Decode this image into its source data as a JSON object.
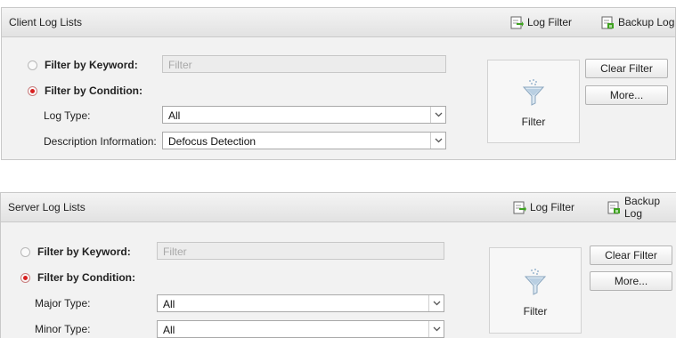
{
  "client": {
    "title": "Client Log Lists",
    "log_filter": "Log Filter",
    "backup_log": "Backup Log",
    "filter_keyword_label": "Filter by Keyword:",
    "filter_keyword_placeholder": "Filter",
    "filter_condition_label": "Filter by Condition:",
    "field1_label": "Log Type:",
    "field1_value": "All",
    "field2_label": "Description Information:",
    "field2_value": "Defocus Detection",
    "filter_button": "Filter",
    "clear_filter": "Clear Filter",
    "more": "More..."
  },
  "server": {
    "title": "Server Log Lists",
    "log_filter": "Log Filter",
    "backup_log": "Backup Log",
    "filter_keyword_label": "Filter by Keyword:",
    "filter_keyword_placeholder": "Filter",
    "filter_condition_label": "Filter by Condition:",
    "field1_label": "Major Type:",
    "field1_value": "All",
    "field2_label": "Minor Type:",
    "field2_value": "All",
    "filter_button": "Filter",
    "clear_filter": "Clear Filter",
    "more": "More..."
  },
  "icons": {
    "log_filter": "log-filter-icon",
    "backup_log": "backup-log-icon",
    "filter": "funnel-icon",
    "dropdown": "chevron-down-icon"
  },
  "colors": {
    "radio_selected": "#d81e1e",
    "panel_bg": "#f2f2f2",
    "header_bg": "#e6e6e6"
  }
}
